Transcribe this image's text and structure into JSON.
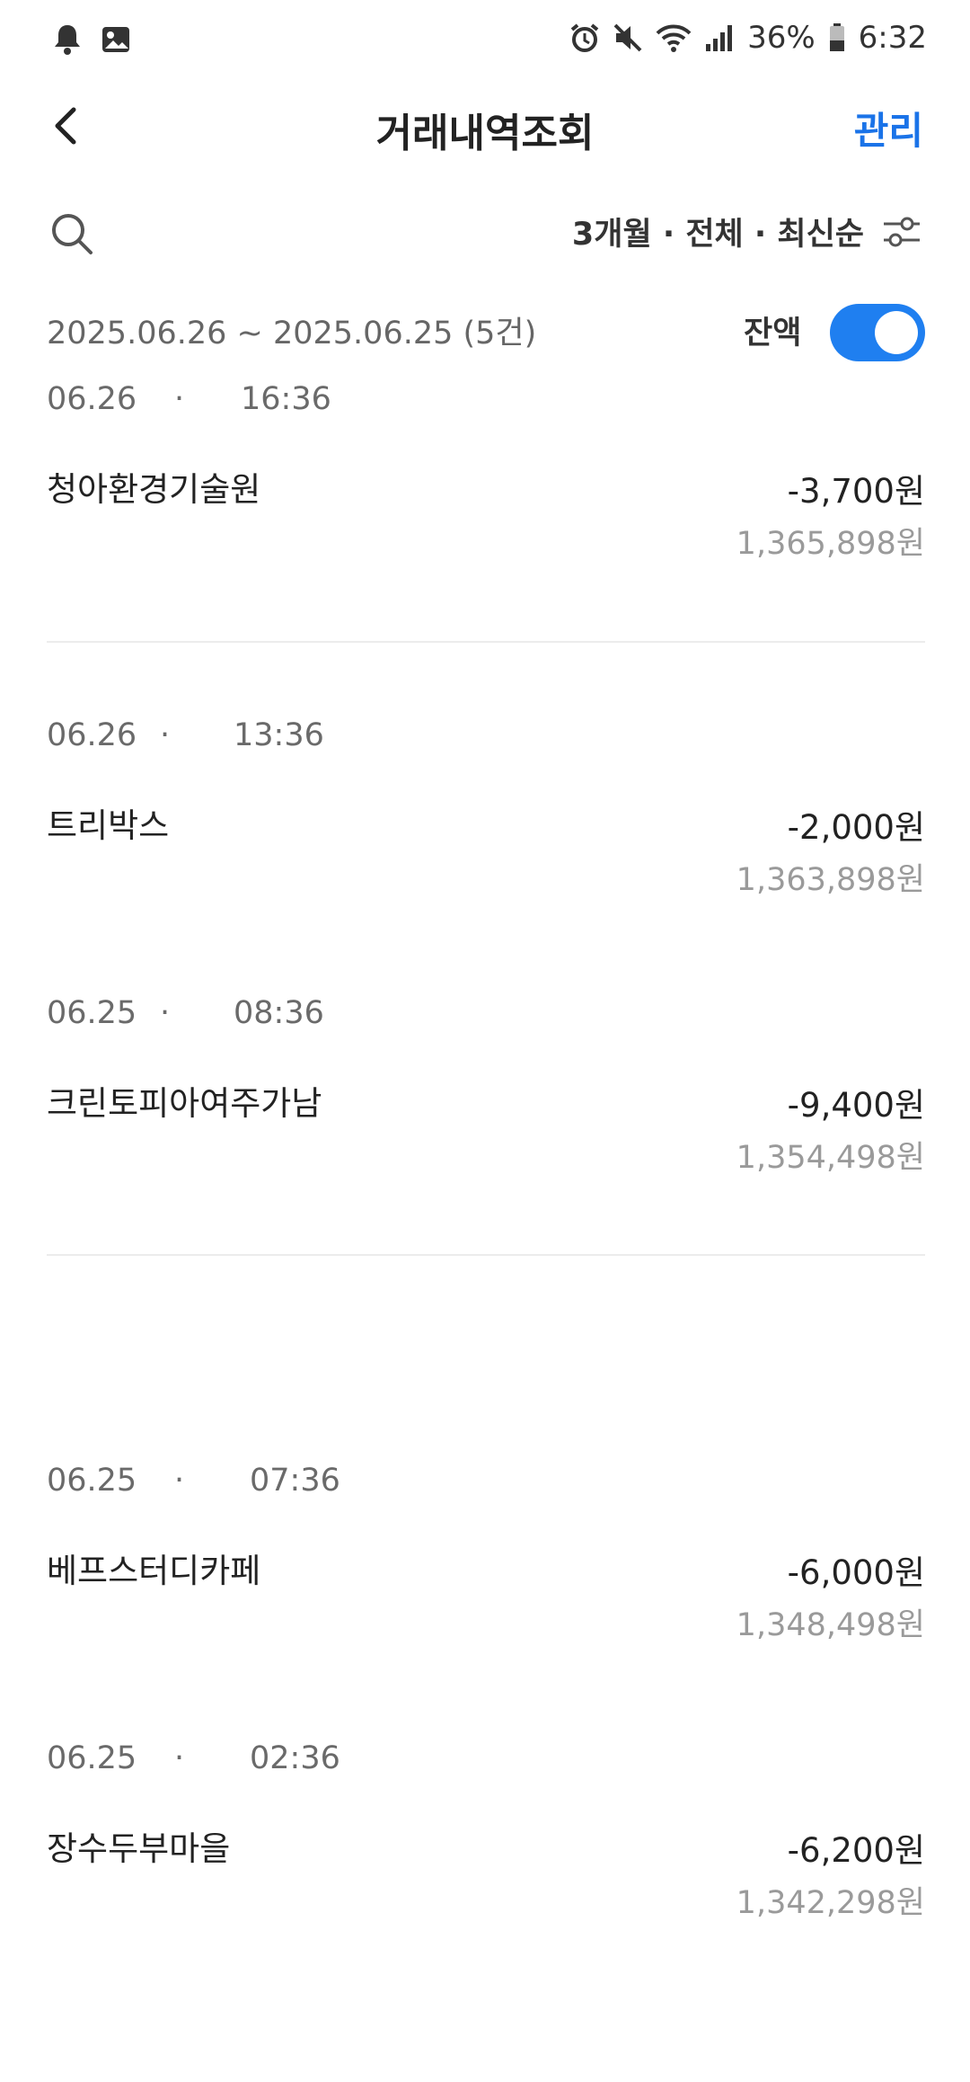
{
  "status_bar": {
    "battery": "36%",
    "time": "6:32",
    "icons_left": [
      "notification-bell-icon",
      "gallery-image-icon"
    ],
    "icons_right": [
      "alarm-icon",
      "mute-icon",
      "wifi-icon",
      "signal-icon",
      "battery-icon"
    ]
  },
  "header": {
    "title": "거래내역조회",
    "manage_label": "관리"
  },
  "filter": {
    "label": "3개월 · 전체 · 최신순"
  },
  "summary": {
    "range": "2025.06.26 ~ 2025.06.25 (5건)",
    "balance_label": "잔액",
    "balance_toggle_on": true
  },
  "colors": {
    "accent": "#1f7ff0",
    "link": "#1a73e8"
  },
  "transactions": [
    {
      "date": "06.26",
      "sep": "·",
      "time": "16:36",
      "name": "청아환경기술원",
      "amount": "-3,700원",
      "balance": "1,365,898원"
    },
    {
      "date": "06.26",
      "sep": "·",
      "time": "13:36",
      "name": "트리박스",
      "amount": "-2,000원",
      "balance": "1,363,898원"
    },
    {
      "date": "06.25",
      "sep": "·",
      "time": "08:36",
      "name": "크린토피아여주가남",
      "amount": "-9,400원",
      "balance": "1,354,498원"
    },
    {
      "date": "06.25",
      "sep": "·",
      "time": "07:36",
      "name": "베프스터디카페",
      "amount": "-6,000원",
      "balance": "1,348,498원"
    },
    {
      "date": "06.25",
      "sep": "·",
      "time": "02:36",
      "name": "장수두부마을",
      "amount": "-6,200원",
      "balance": "1,342,298원"
    }
  ]
}
